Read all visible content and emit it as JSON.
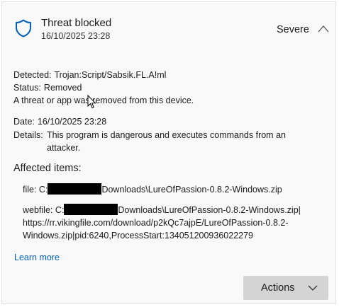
{
  "header": {
    "title": "Threat blocked",
    "timestamp": "16/10/2025 23:28",
    "severity": "Severe",
    "icon": "shield-icon",
    "accent_color": "#005fb8"
  },
  "details": {
    "detected_label": "Detected:",
    "detected_value": "Trojan:Script/Sabsik.FL.A!ml",
    "status_label": "Status:",
    "status_value": "Removed",
    "status_note": "A threat or app was removed from this device.",
    "date_label": "Date:",
    "date_value": "16/10/2025 23:28",
    "details_label": "Details:",
    "details_value": "This program is dangerous and executes commands from an attacker."
  },
  "affected": {
    "title": "Affected items:",
    "items": [
      {
        "prefix": "file: C:",
        "suffix": "Downloads\\LureOfPassion-0.8.2-Windows.zip"
      },
      {
        "prefix": "webfile: C:",
        "line1_suffix": "Downloads\\LureOfPassion-0.8.2-Windows.zip|",
        "line2": "https://rr.vikingfile.com/download/p2kQc7ajpE/LureOfPassion-0.8.2-",
        "line3": "Windows.zip|pid:6240,ProcessStart:134051200936022279"
      }
    ]
  },
  "links": {
    "learn_more": "Learn more"
  },
  "actions": {
    "label": "Actions"
  }
}
